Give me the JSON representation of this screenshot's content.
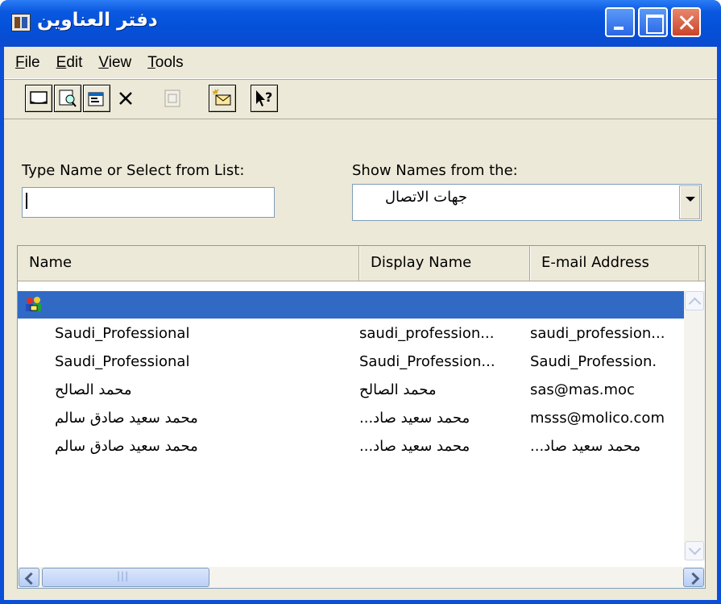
{
  "window": {
    "title": "دفتر العناوين"
  },
  "menu": {
    "file": "File",
    "edit": "Edit",
    "view": "View",
    "tools": "Tools"
  },
  "toolbar": {
    "icons": [
      "new-contact-icon",
      "properties-find-icon",
      "properties-icon",
      "delete-icon",
      "print-icon",
      "send-mail-icon",
      "help-icon"
    ]
  },
  "search": {
    "type_name_label": "Type Name or Select from List:",
    "type_name_value": "",
    "show_names_label": "Show Names from the:",
    "show_names_value": "جهات الاتصال"
  },
  "list": {
    "columns": [
      "Name",
      "Display Name",
      "E-mail Address"
    ],
    "rows": [
      {
        "name": "Saudi_Professional",
        "display": "saudi_profession...",
        "email": "saudi_profession..."
      },
      {
        "name": "Saudi_Professional",
        "display": "Saudi_Profession...",
        "email": "Saudi_Profession."
      },
      {
        "name": "محمد الصالح",
        "display": "محمد الصالح",
        "email": "sas@mas.moc"
      },
      {
        "name": "محمد سعيد صادق سالم",
        "display": "محمد سعيد صاد...",
        "email": "msss@molico.com"
      },
      {
        "name": "محمد سعيد صادق سالم",
        "display": "محمد سعيد صاد...",
        "email": "محمد سعيد صاد..."
      }
    ]
  },
  "colors": {
    "titlebar": "#0451d8",
    "selection": "#316ac5",
    "face": "#ece9d8"
  }
}
